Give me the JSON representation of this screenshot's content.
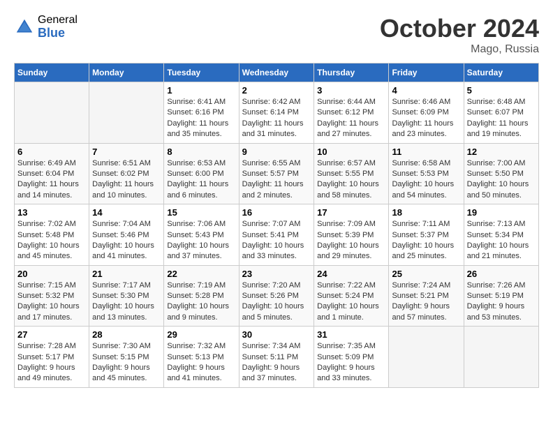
{
  "logo": {
    "general": "General",
    "blue": "Blue"
  },
  "header": {
    "month": "October 2024",
    "location": "Mago, Russia"
  },
  "days_of_week": [
    "Sunday",
    "Monday",
    "Tuesday",
    "Wednesday",
    "Thursday",
    "Friday",
    "Saturday"
  ],
  "weeks": [
    [
      {
        "day": "",
        "empty": true
      },
      {
        "day": "",
        "empty": true
      },
      {
        "day": "1",
        "sunrise": "6:41 AM",
        "sunset": "6:16 PM",
        "daylight": "11 hours and 35 minutes."
      },
      {
        "day": "2",
        "sunrise": "6:42 AM",
        "sunset": "6:14 PM",
        "daylight": "11 hours and 31 minutes."
      },
      {
        "day": "3",
        "sunrise": "6:44 AM",
        "sunset": "6:12 PM",
        "daylight": "11 hours and 27 minutes."
      },
      {
        "day": "4",
        "sunrise": "6:46 AM",
        "sunset": "6:09 PM",
        "daylight": "11 hours and 23 minutes."
      },
      {
        "day": "5",
        "sunrise": "6:48 AM",
        "sunset": "6:07 PM",
        "daylight": "11 hours and 19 minutes."
      }
    ],
    [
      {
        "day": "6",
        "sunrise": "6:49 AM",
        "sunset": "6:04 PM",
        "daylight": "11 hours and 14 minutes."
      },
      {
        "day": "7",
        "sunrise": "6:51 AM",
        "sunset": "6:02 PM",
        "daylight": "11 hours and 10 minutes."
      },
      {
        "day": "8",
        "sunrise": "6:53 AM",
        "sunset": "6:00 PM",
        "daylight": "11 hours and 6 minutes."
      },
      {
        "day": "9",
        "sunrise": "6:55 AM",
        "sunset": "5:57 PM",
        "daylight": "11 hours and 2 minutes."
      },
      {
        "day": "10",
        "sunrise": "6:57 AM",
        "sunset": "5:55 PM",
        "daylight": "10 hours and 58 minutes."
      },
      {
        "day": "11",
        "sunrise": "6:58 AM",
        "sunset": "5:53 PM",
        "daylight": "10 hours and 54 minutes."
      },
      {
        "day": "12",
        "sunrise": "7:00 AM",
        "sunset": "5:50 PM",
        "daylight": "10 hours and 50 minutes."
      }
    ],
    [
      {
        "day": "13",
        "sunrise": "7:02 AM",
        "sunset": "5:48 PM",
        "daylight": "10 hours and 45 minutes."
      },
      {
        "day": "14",
        "sunrise": "7:04 AM",
        "sunset": "5:46 PM",
        "daylight": "10 hours and 41 minutes."
      },
      {
        "day": "15",
        "sunrise": "7:06 AM",
        "sunset": "5:43 PM",
        "daylight": "10 hours and 37 minutes."
      },
      {
        "day": "16",
        "sunrise": "7:07 AM",
        "sunset": "5:41 PM",
        "daylight": "10 hours and 33 minutes."
      },
      {
        "day": "17",
        "sunrise": "7:09 AM",
        "sunset": "5:39 PM",
        "daylight": "10 hours and 29 minutes."
      },
      {
        "day": "18",
        "sunrise": "7:11 AM",
        "sunset": "5:37 PM",
        "daylight": "10 hours and 25 minutes."
      },
      {
        "day": "19",
        "sunrise": "7:13 AM",
        "sunset": "5:34 PM",
        "daylight": "10 hours and 21 minutes."
      }
    ],
    [
      {
        "day": "20",
        "sunrise": "7:15 AM",
        "sunset": "5:32 PM",
        "daylight": "10 hours and 17 minutes."
      },
      {
        "day": "21",
        "sunrise": "7:17 AM",
        "sunset": "5:30 PM",
        "daylight": "10 hours and 13 minutes."
      },
      {
        "day": "22",
        "sunrise": "7:19 AM",
        "sunset": "5:28 PM",
        "daylight": "10 hours and 9 minutes."
      },
      {
        "day": "23",
        "sunrise": "7:20 AM",
        "sunset": "5:26 PM",
        "daylight": "10 hours and 5 minutes."
      },
      {
        "day": "24",
        "sunrise": "7:22 AM",
        "sunset": "5:24 PM",
        "daylight": "10 hours and 1 minute."
      },
      {
        "day": "25",
        "sunrise": "7:24 AM",
        "sunset": "5:21 PM",
        "daylight": "9 hours and 57 minutes."
      },
      {
        "day": "26",
        "sunrise": "7:26 AM",
        "sunset": "5:19 PM",
        "daylight": "9 hours and 53 minutes."
      }
    ],
    [
      {
        "day": "27",
        "sunrise": "7:28 AM",
        "sunset": "5:17 PM",
        "daylight": "9 hours and 49 minutes."
      },
      {
        "day": "28",
        "sunrise": "7:30 AM",
        "sunset": "5:15 PM",
        "daylight": "9 hours and 45 minutes."
      },
      {
        "day": "29",
        "sunrise": "7:32 AM",
        "sunset": "5:13 PM",
        "daylight": "9 hours and 41 minutes."
      },
      {
        "day": "30",
        "sunrise": "7:34 AM",
        "sunset": "5:11 PM",
        "daylight": "9 hours and 37 minutes."
      },
      {
        "day": "31",
        "sunrise": "7:35 AM",
        "sunset": "5:09 PM",
        "daylight": "9 hours and 33 minutes."
      },
      {
        "day": "",
        "empty": true
      },
      {
        "day": "",
        "empty": true
      }
    ]
  ]
}
